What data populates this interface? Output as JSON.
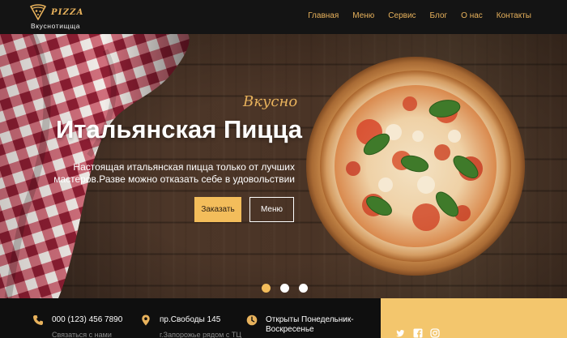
{
  "brand": {
    "logo_text": "PIZZA",
    "tagline": "Вкуснотищща",
    "accent_color": "#e8b25c",
    "button_color": "#f3bd5b"
  },
  "nav": {
    "items": [
      {
        "label": "Главная"
      },
      {
        "label": "Меню"
      },
      {
        "label": "Сервис"
      },
      {
        "label": "Блог"
      },
      {
        "label": "О нас"
      },
      {
        "label": "Контакты"
      }
    ]
  },
  "hero": {
    "script": "Вкусно",
    "title": "Итальянская Пицца",
    "description": "Настоящая итальянская пицца только от лучших мастеров.Разве можно отказать себе в удовольствии",
    "order_button": "Заказать",
    "menu_button": "Меню",
    "slides_total": 3,
    "active_slide": 1
  },
  "info": {
    "phone": {
      "icon": "phone-icon",
      "main": "000 (123) 456 7890",
      "sub": "Связаться с нами"
    },
    "address": {
      "icon": "location-pin-icon",
      "main": "пр.Свободы 145",
      "sub": "г.Запорожье рядом с ТЦ"
    },
    "hours": {
      "icon": "clock-icon",
      "main": "Открыты Понедельник-Воскресенье"
    },
    "social": [
      "twitter-icon",
      "facebook-icon",
      "instagram-icon"
    ]
  }
}
